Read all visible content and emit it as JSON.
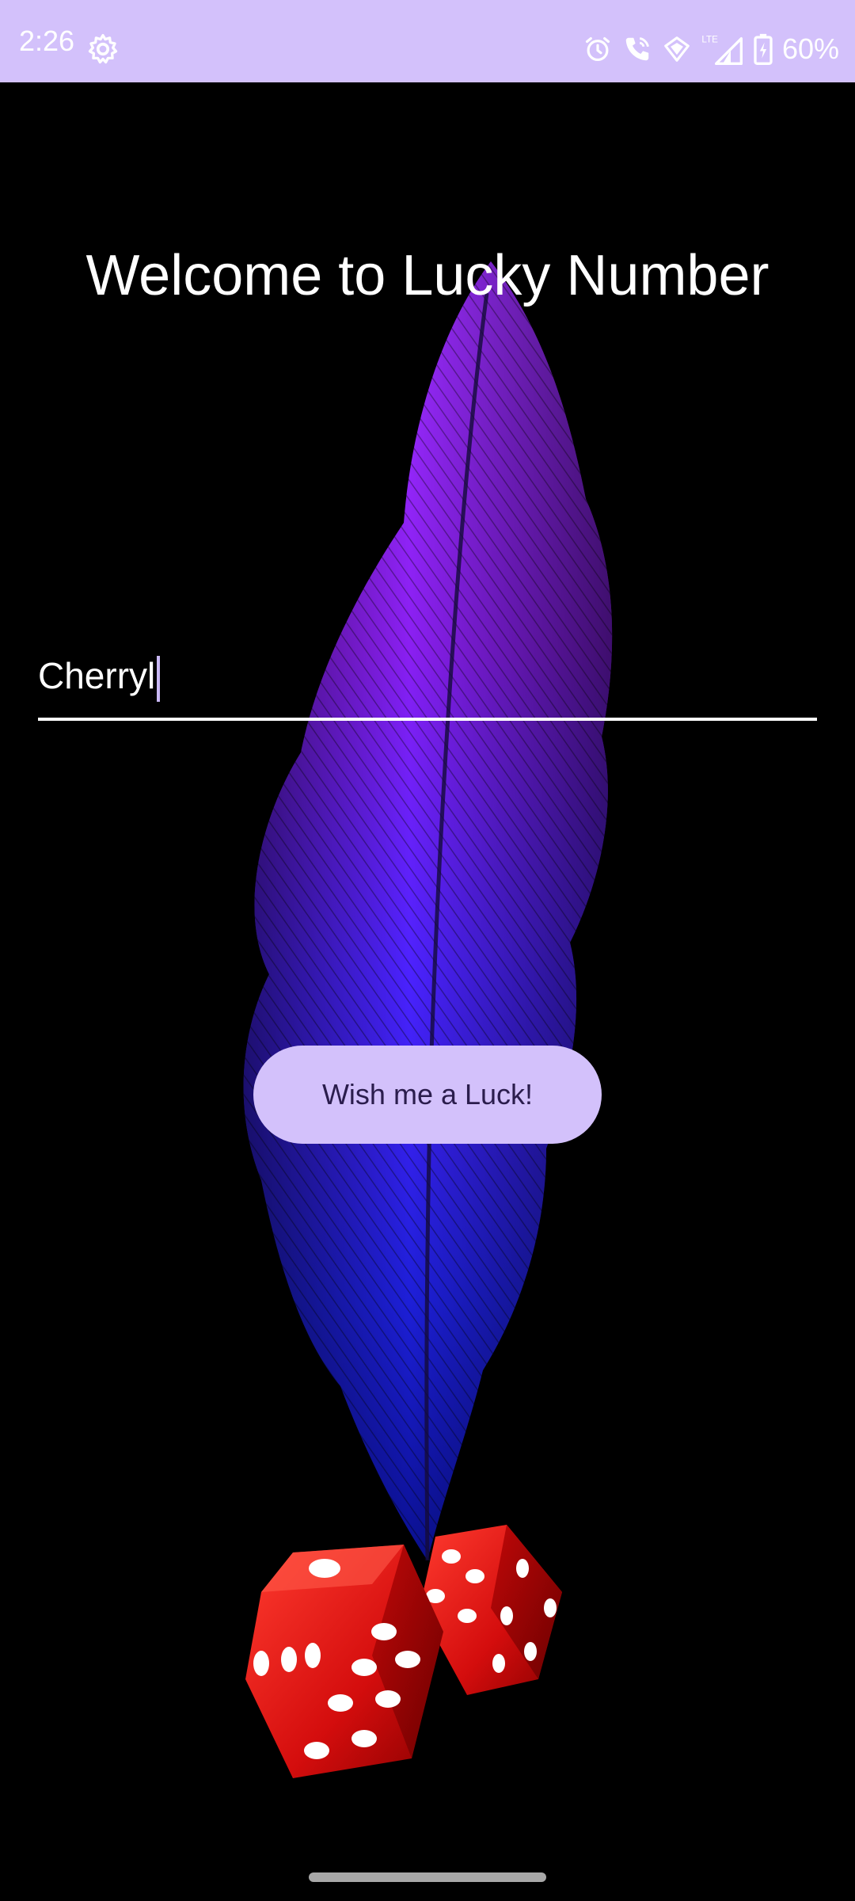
{
  "status_bar": {
    "time": "2:26",
    "battery": "60%",
    "icons": [
      "settings-gear-icon",
      "alarm-icon",
      "wifi-calling-icon",
      "data-saver-icon",
      "lte-signal-icon",
      "battery-charging-icon"
    ],
    "background": "#d3c1fb"
  },
  "main": {
    "title": "Welcome to Lucky Number",
    "name_input": {
      "value": "Cherryl"
    },
    "luck_button": {
      "label": "Wish me a Luck!",
      "background": "#d3c1fb",
      "text_color": "#2b1d4d"
    }
  },
  "images": {
    "background": "feather-image",
    "footer": "red-dice-image"
  }
}
